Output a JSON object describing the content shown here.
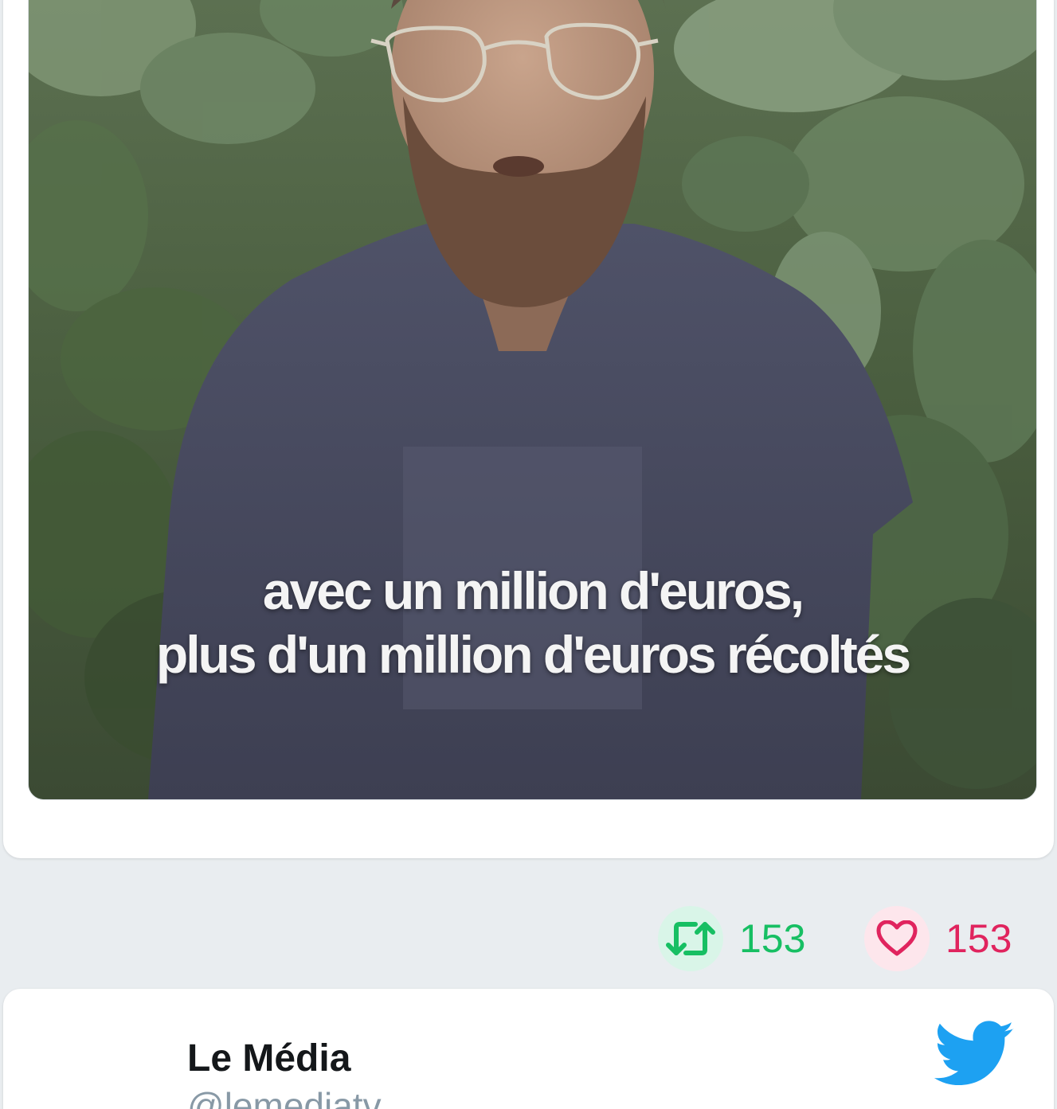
{
  "video": {
    "subtitle_line1": "avec un million d'euros,",
    "subtitle_line2": "plus d'un million d'euros récoltés"
  },
  "actions": {
    "retweet_count": "153",
    "like_count": "153"
  },
  "next_tweet": {
    "author_name": "Le Média",
    "author_handle": "@lemediatv"
  },
  "colors": {
    "retweet": "#17bf63",
    "like": "#e0245e",
    "twitter_blue": "#1da1f2",
    "background": "#e9edf0"
  },
  "icons": {
    "retweet": "retweet-icon",
    "like": "heart-icon",
    "brand": "twitter-bird-icon"
  }
}
